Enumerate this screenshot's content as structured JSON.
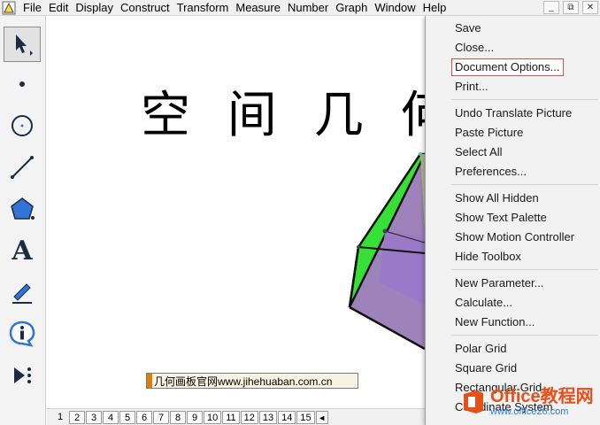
{
  "menubar": {
    "items": [
      "File",
      "Edit",
      "Display",
      "Construct",
      "Transform",
      "Measure",
      "Number",
      "Graph",
      "Window",
      "Help"
    ],
    "window_controls": {
      "minimize": "_",
      "restore": "⧉",
      "close": "✕"
    }
  },
  "toolbox": {
    "tools": [
      "arrow-select",
      "point",
      "compass",
      "straightedge",
      "polygon",
      "text",
      "marker",
      "information",
      "custom-tools"
    ],
    "text_tool_label": "A"
  },
  "canvas": {
    "title": "空 间 几 何 体",
    "watermark": "几何画板官网www.jihehuaban.com.cn",
    "colors": {
      "green_face": "#36e036",
      "purple_face": "#9e82ba",
      "purple_top": "#9a7ac8"
    }
  },
  "pages": {
    "current": "1",
    "tabs": [
      "2",
      "3",
      "4",
      "5",
      "6",
      "7",
      "8",
      "9",
      "10",
      "11",
      "12",
      "13",
      "14",
      "15"
    ],
    "scroll_left": "◄"
  },
  "context_menu": {
    "groups": [
      [
        "Save",
        "Close...",
        "Document Options...",
        "Print..."
      ],
      [
        "Undo Translate Picture",
        "Paste Picture",
        "Select All",
        "Preferences..."
      ],
      [
        "Show All Hidden",
        "Show Text Palette",
        "Show Motion Controller",
        "Hide Toolbox"
      ],
      [
        "New Parameter...",
        "Calculate...",
        "New Function..."
      ],
      [
        "Polar Grid",
        "Square Grid",
        "Rectangular Grid",
        "Coordinate System"
      ]
    ],
    "highlighted": "Document Options...",
    "highlight_color": "#e04b4b"
  },
  "site_badge": {
    "title": "Office教程网",
    "url": "www.office26.com"
  }
}
